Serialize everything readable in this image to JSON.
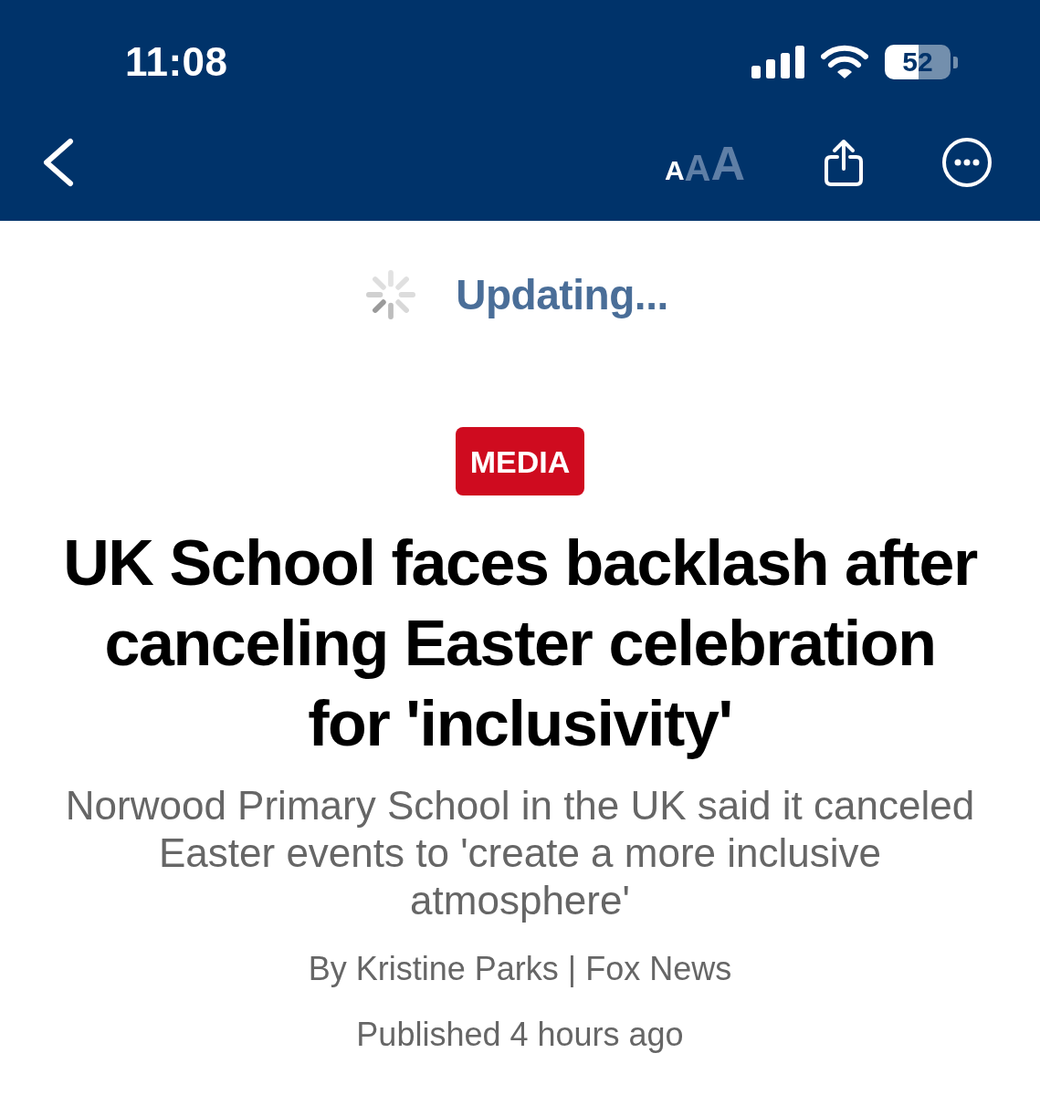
{
  "status_bar": {
    "time": "11:08",
    "battery": "52"
  },
  "toolbar": {
    "text_size": [
      {
        "text": "A",
        "selected": true
      },
      {
        "text": "A",
        "selected": false
      },
      {
        "text": "A",
        "selected": false
      }
    ]
  },
  "loading": {
    "label": "Updating..."
  },
  "article": {
    "category": "MEDIA",
    "headline": "UK School faces backlash after canceling Easter celebration for 'inclusivity'",
    "summary": "Norwood Primary School in the UK said it canceled Easter events to 'create a more inclusive atmosphere'",
    "byline": "By Kristine Parks | Fox News",
    "published": "Published 4 hours ago"
  }
}
